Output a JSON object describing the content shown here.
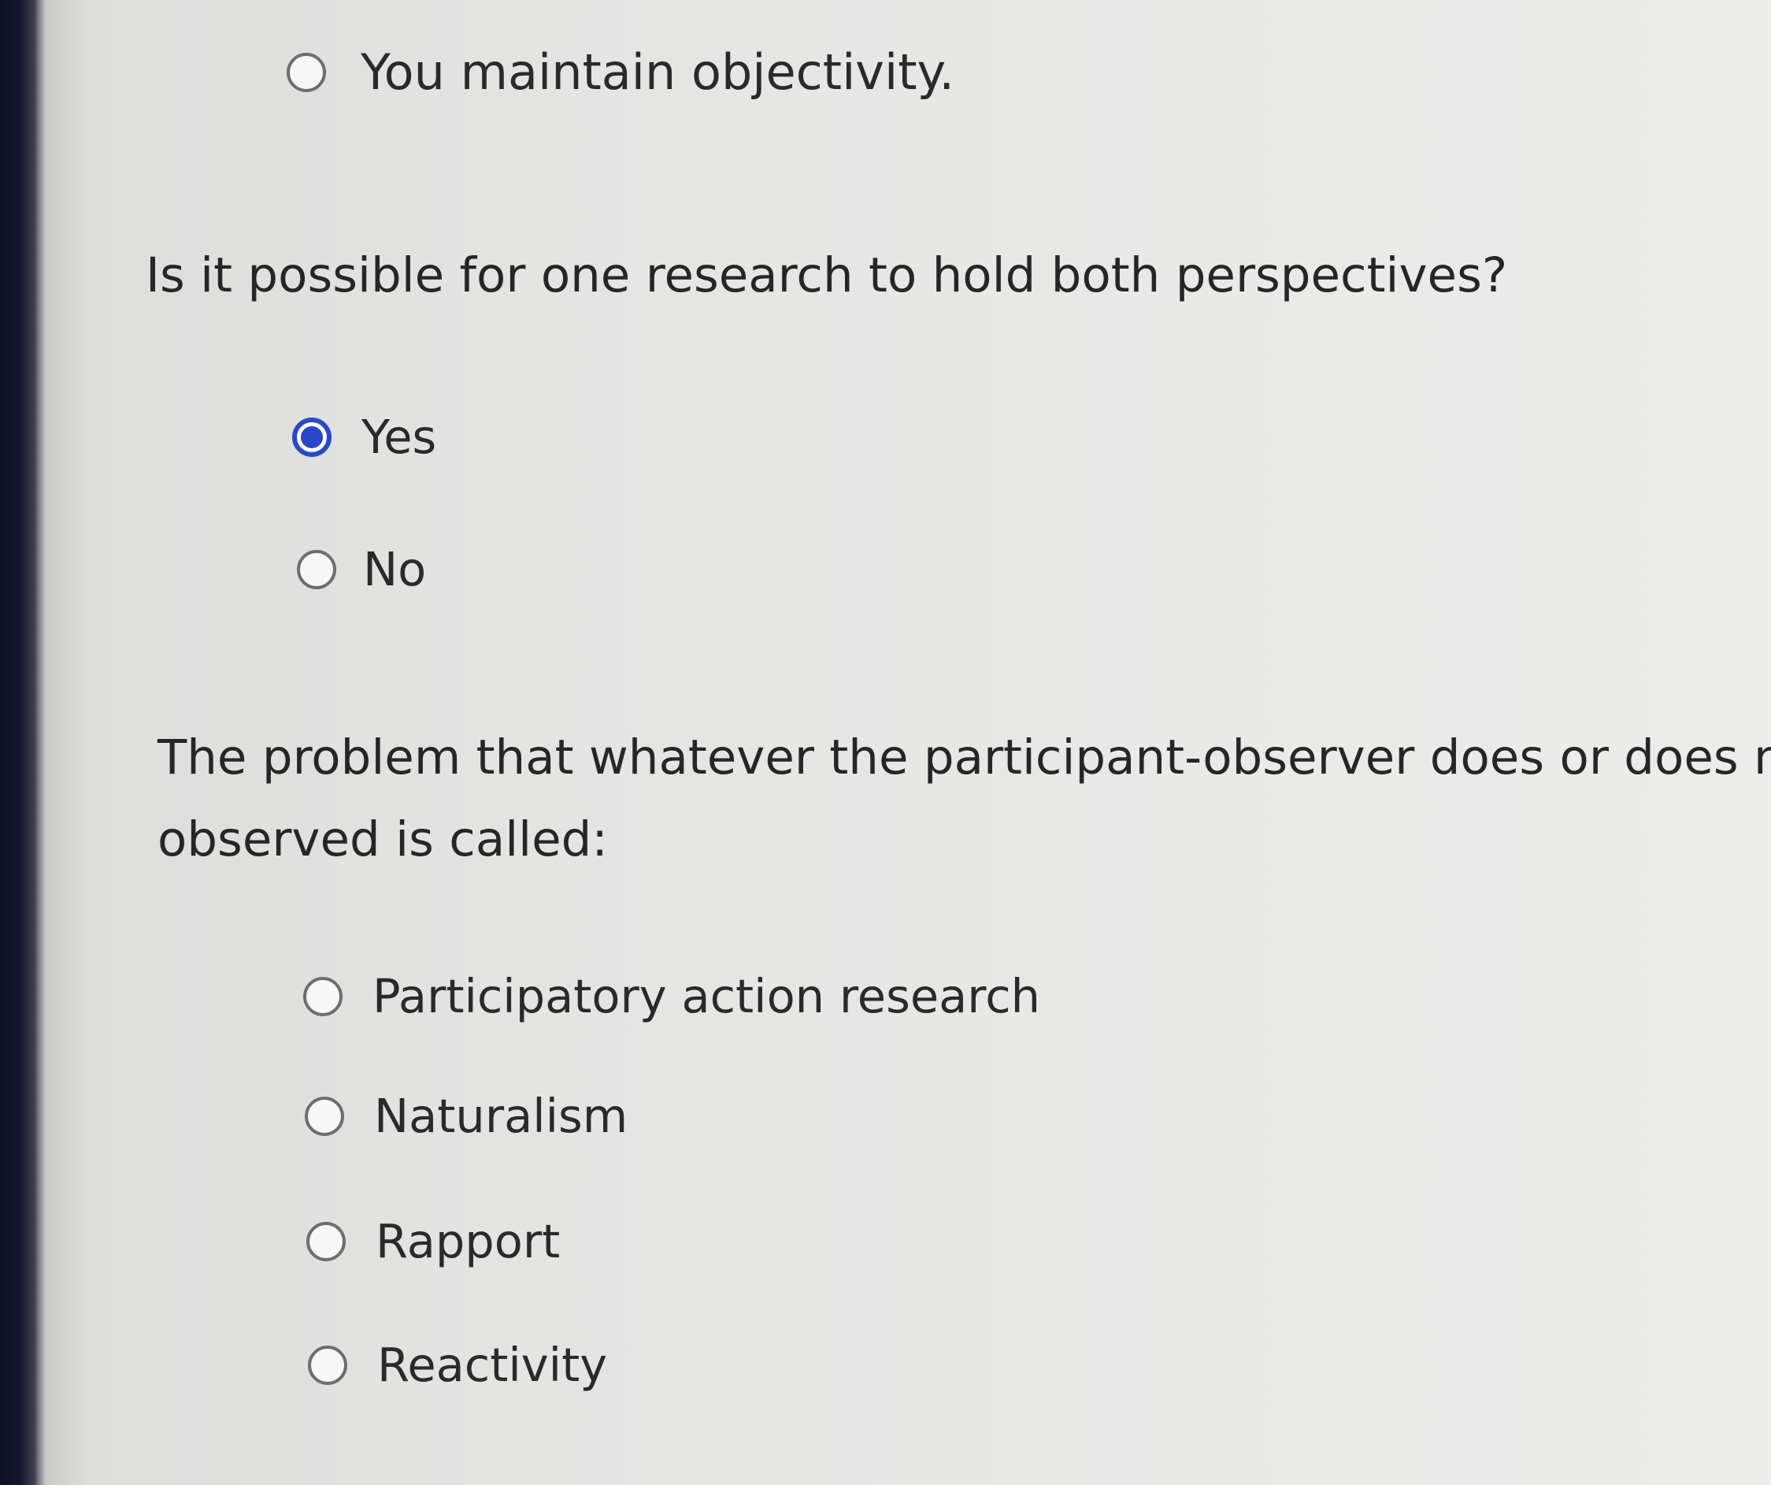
{
  "questions": [
    {
      "text_lines": [],
      "options": [
        {
          "label": "You maintain objectivity.",
          "selected": false
        }
      ]
    },
    {
      "text_lines": [
        "Is it possible for one research to hold both perspectives?"
      ],
      "options": [
        {
          "label": "Yes",
          "selected": true
        },
        {
          "label": "No",
          "selected": false
        }
      ]
    },
    {
      "text_lines": [
        "The problem that whatever the participant-observer does or does not do i",
        "observed is called:"
      ],
      "options": [
        {
          "label": "Participatory action research",
          "selected": false
        },
        {
          "label": "Naturalism",
          "selected": false
        },
        {
          "label": "Rapport",
          "selected": false
        },
        {
          "label": "Reactivity",
          "selected": false
        }
      ]
    }
  ],
  "colors": {
    "selected_radio": "#2846c6",
    "radio_border": "#6e6e6e",
    "text": "#262626"
  }
}
